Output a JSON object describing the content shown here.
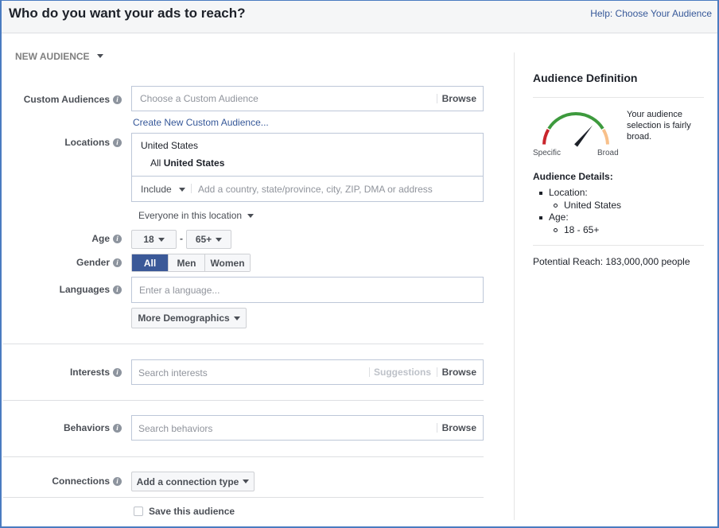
{
  "header": {
    "title": "Who do you want your ads to reach?",
    "help_link": "Help: Choose Your Audience"
  },
  "audience_selector": {
    "label": "NEW AUDIENCE"
  },
  "custom_audiences": {
    "label": "Custom Audiences",
    "placeholder": "Choose a Custom Audience",
    "browse": "Browse",
    "create_link": "Create New Custom Audience..."
  },
  "locations": {
    "label": "Locations",
    "selected_country": "United States",
    "scope_prefix": "All",
    "scope_value": "United States",
    "include_label": "Include",
    "placeholder": "Add a country, state/province, city, ZIP, DMA or address",
    "people_filter": "Everyone in this location"
  },
  "age": {
    "label": "Age",
    "min": "18",
    "max": "65+",
    "separator": "-"
  },
  "gender": {
    "label": "Gender",
    "options": [
      "All",
      "Men",
      "Women"
    ],
    "selected": "All"
  },
  "languages": {
    "label": "Languages",
    "placeholder": "Enter a language..."
  },
  "more_demographics": {
    "label": "More Demographics"
  },
  "interests": {
    "label": "Interests",
    "placeholder": "Search interests",
    "suggestions": "Suggestions",
    "browse": "Browse"
  },
  "behaviors": {
    "label": "Behaviors",
    "placeholder": "Search behaviors",
    "browse": "Browse"
  },
  "connections": {
    "label": "Connections",
    "button": "Add a connection type"
  },
  "save_audience": {
    "label": "Save this audience",
    "checked": false
  },
  "audience_definition": {
    "title": "Audience Definition",
    "gauge": {
      "description": "Your audience selection is fairly broad.",
      "left_label": "Specific",
      "right_label": "Broad",
      "level": 0.72,
      "colors": {
        "specific": "#c9252c",
        "middle": "#3d9a3d",
        "broad": "#f8c08a",
        "needle": "#1d2129"
      }
    },
    "details_title": "Audience Details:",
    "details": [
      {
        "label": "Location:",
        "values": [
          "United States"
        ]
      },
      {
        "label": "Age:",
        "values": [
          "18 - 65+"
        ]
      }
    ],
    "potential_reach": "Potential Reach: 183,000,000 people"
  },
  "colors": {
    "accent": "#3b5998",
    "link": "#365899",
    "frame_border": "#4a7bc0"
  }
}
